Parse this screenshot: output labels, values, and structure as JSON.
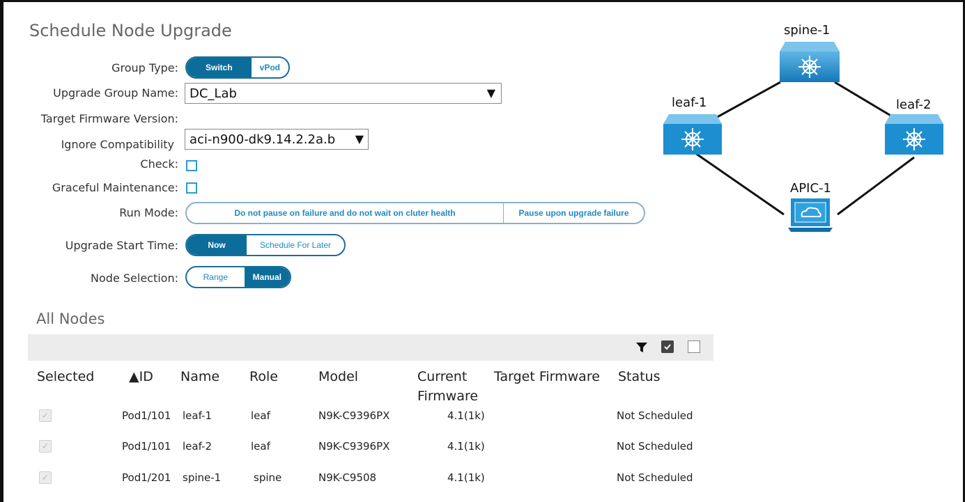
{
  "page": {
    "title": "Schedule Node Upgrade"
  },
  "form": {
    "group_type": {
      "label": "Group Type:",
      "options": [
        "Switch",
        "vPod"
      ],
      "selected": "Switch"
    },
    "group_name": {
      "label": "Upgrade Group Name:",
      "value": "DC_Lab"
    },
    "target_fw": {
      "label": "Target Firmware Version:",
      "value": "aci-n900-dk9.14.2.2a.b"
    },
    "ignore_compat": {
      "label_line1": "Ignore Compatibility",
      "label_line2": "Check:",
      "checked": false
    },
    "graceful": {
      "label": "Graceful Maintenance:",
      "checked": false
    },
    "run_mode": {
      "label": "Run Mode:",
      "options": [
        "Do not pause on failure and do not wait on cluter health",
        "Pause upon upgrade failure"
      ]
    },
    "start_time": {
      "label": "Upgrade Start Time:",
      "options": [
        "Now",
        "Schedule For Later"
      ],
      "selected": "Now"
    },
    "node_selection": {
      "label": "Node Selection:",
      "options": [
        "Range",
        "Manual"
      ],
      "selected": "Manual"
    }
  },
  "nodes_section": {
    "title": "All Nodes",
    "columns": [
      "Selected",
      "▲ID",
      "Name",
      "Role",
      "Model",
      "Current",
      "Firmware",
      "Target Firmware",
      "Status"
    ],
    "rows": [
      {
        "id": "Pod1/101",
        "name": "leaf-1",
        "role": "leaf",
        "model": "N9K-C9396PX",
        "current_fw": "4.1(1k)",
        "target_fw": "",
        "status": "Not Scheduled"
      },
      {
        "id": "Pod1/101",
        "name": "leaf-2",
        "role": "leaf",
        "model": "N9K-C9396PX",
        "current_fw": "4.1(1k)",
        "target_fw": "",
        "status": "Not Scheduled"
      },
      {
        "id": "Pod1/201",
        "name": "spine-1",
        "role": "spine",
        "model": "N9K-C9508",
        "current_fw": "4.1(1k)",
        "target_fw": "",
        "status": "Not Scheduled"
      }
    ]
  },
  "topology": {
    "nodes": {
      "spine": "spine-1",
      "leaf1": "leaf-1",
      "leaf2": "leaf-2",
      "apic": "APIC-1"
    }
  },
  "colors": {
    "accent": "#0c6d9a",
    "accent_text": "#1f8bc0",
    "switch_blue": "#1d8fd0"
  }
}
